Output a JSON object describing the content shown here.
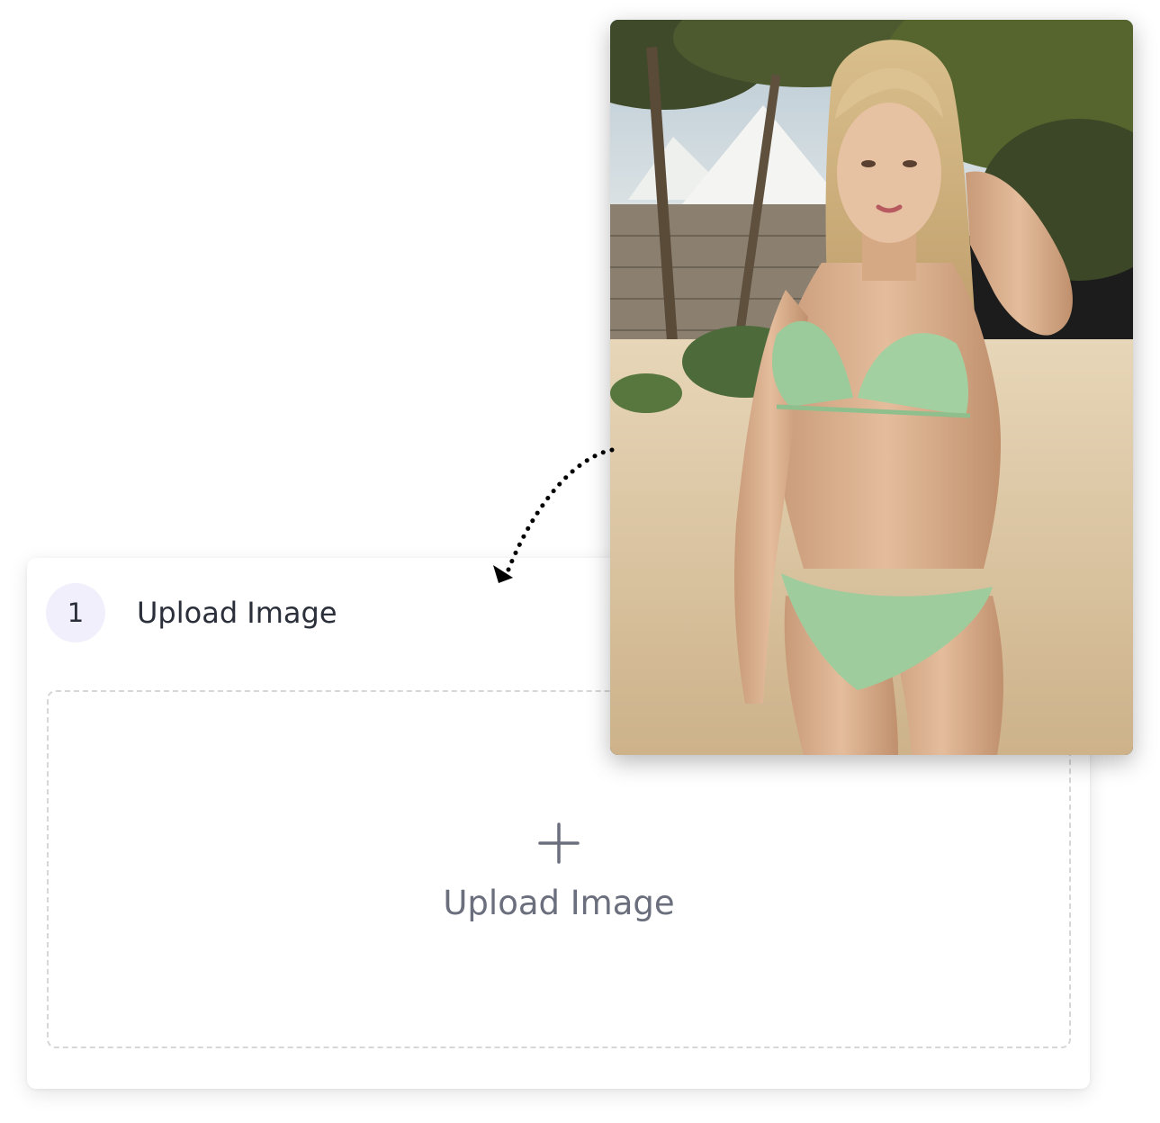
{
  "upload_step": {
    "number": "1",
    "title": "Upload Image"
  },
  "dropzone": {
    "icon": "plus-icon",
    "label": "Upload Image"
  },
  "example_photo": {
    "icon": "photo-of-woman-in-green-bikini-on-beach"
  },
  "colors": {
    "badge_bg": "#f1effc",
    "text_dark": "#2b2f3a",
    "text_muted": "#6b6f7d",
    "dashed_border": "#d7d7da"
  }
}
